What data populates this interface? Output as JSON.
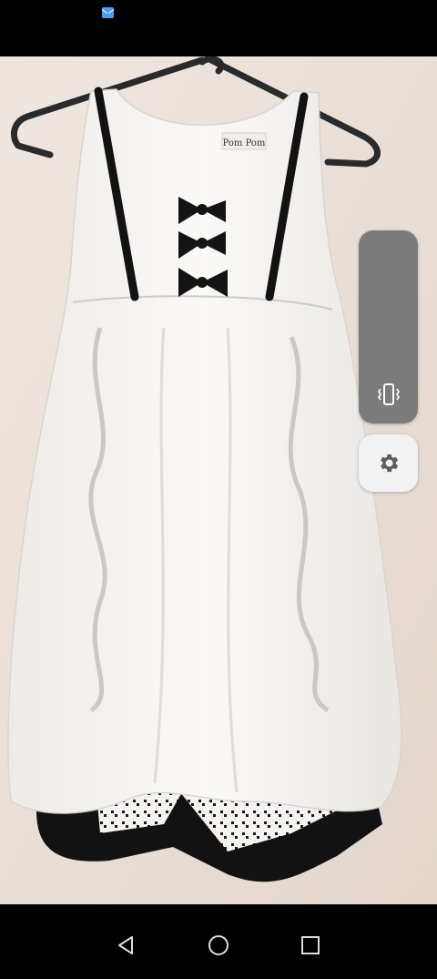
{
  "status_bar": {
    "notification_icons": [
      "mail-icon"
    ]
  },
  "photo": {
    "subject": "dress-on-hanger",
    "label_text": "Pom Pom",
    "colors": {
      "wall": "#e9ded6",
      "dress": "#f7f5f2",
      "trim": "#121212"
    }
  },
  "volume_panel": {
    "mode": "vibrate",
    "icon": "vibrate-icon",
    "settings_icon": "gear-icon",
    "colors": {
      "panel": "#7b7b7b",
      "settings_button": "#f2f2f2"
    }
  },
  "nav_bar": {
    "buttons": [
      "back-icon",
      "home-icon",
      "recents-icon"
    ]
  }
}
